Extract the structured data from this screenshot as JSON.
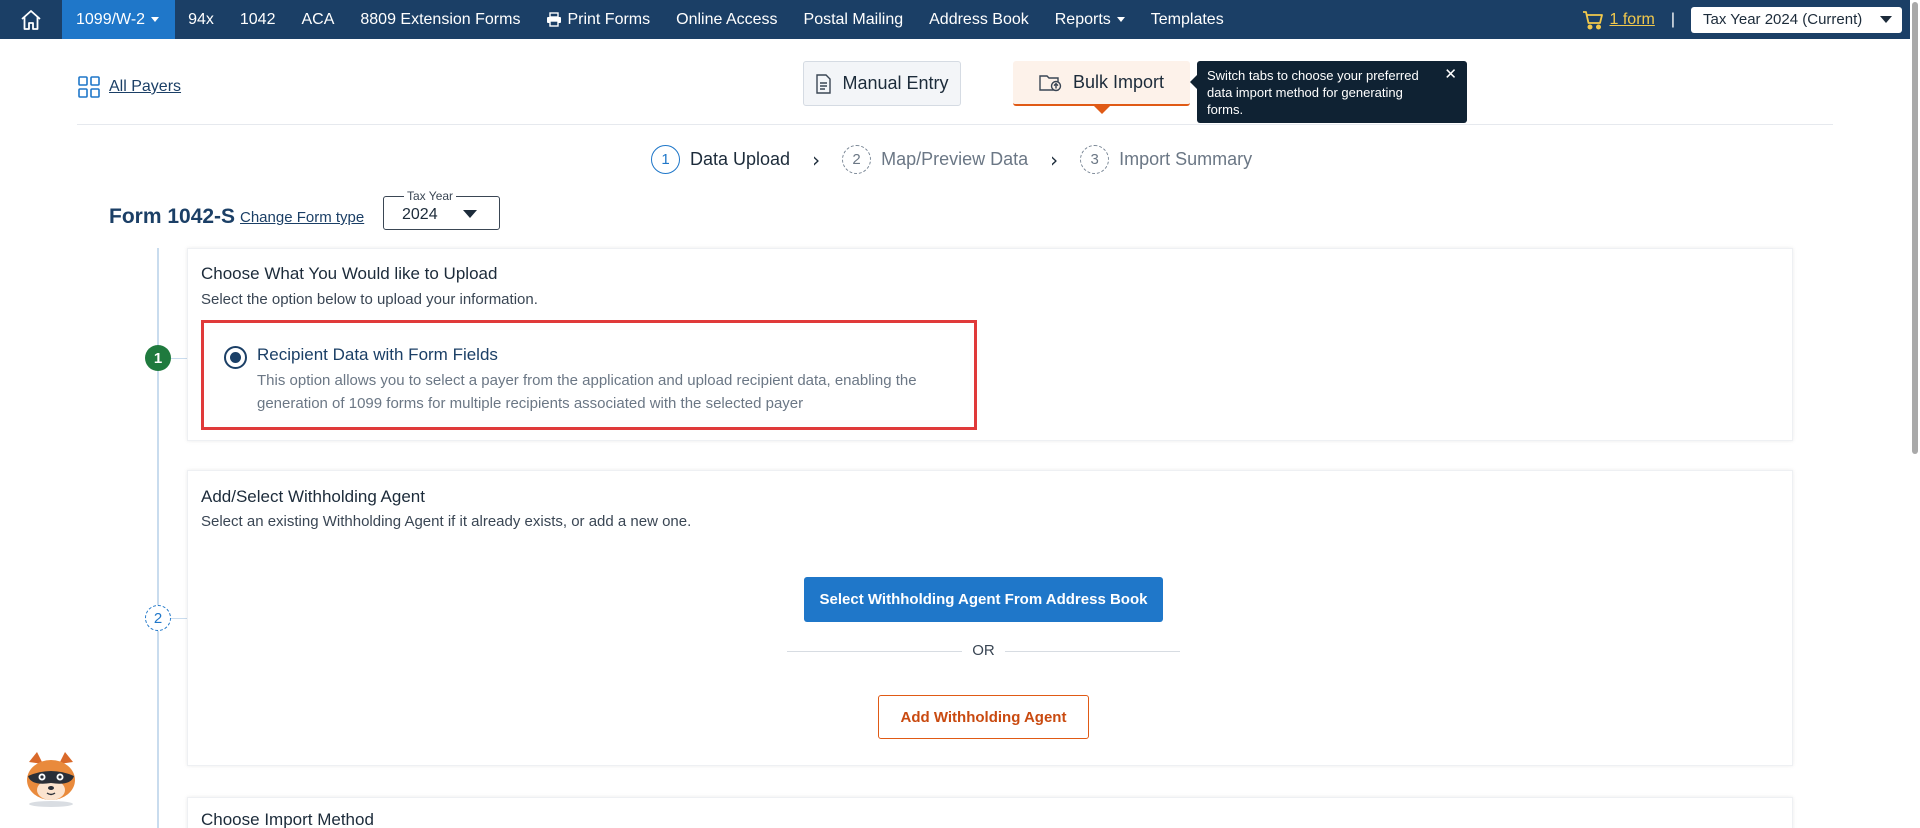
{
  "topnav": {
    "items": [
      {
        "label": "1099/W-2",
        "dropdown": true
      },
      {
        "label": "94x"
      },
      {
        "label": "1042"
      },
      {
        "label": "ACA"
      },
      {
        "label": "8809 Extension Forms"
      },
      {
        "label": "Print Forms",
        "icon": "printer-icon"
      },
      {
        "label": "Online Access"
      },
      {
        "label": "Postal Mailing"
      },
      {
        "label": "Address Book"
      },
      {
        "label": "Reports",
        "dropdown": true
      },
      {
        "label": "Templates"
      }
    ],
    "cart_label": "1 form",
    "separator": "|",
    "tax_year": "Tax Year 2024 (Current)"
  },
  "header": {
    "all_payers": "All Payers",
    "tabs": {
      "manual": "Manual Entry",
      "bulk": "Bulk Import"
    },
    "tooltip": "Switch tabs to choose your preferred data import method for generating forms.",
    "tooltip_close": "✕"
  },
  "stepper": [
    {
      "num": "1",
      "label": "Data Upload"
    },
    {
      "num": "2",
      "label": "Map/Preview Data"
    },
    {
      "num": "3",
      "label": "Import Summary"
    }
  ],
  "form": {
    "title": "Form 1042-S",
    "change_link": "Change Form type",
    "year_legend": "Tax Year",
    "year_value": "2024"
  },
  "steps": {
    "dot1": "1",
    "dot2": "2"
  },
  "card1": {
    "title": "Choose What You Would like to Upload",
    "subtitle": "Select the option below to upload your information.",
    "option_title": "Recipient Data with Form Fields",
    "option_desc": "This option allows you to select a payer from the application and upload recipient data, enabling the generation of 1099 forms for multiple recipients associated with the selected payer"
  },
  "card2": {
    "title": "Add/Select Withholding Agent",
    "subtitle": "Select an existing Withholding Agent if it already exists, or add a new one.",
    "select_button": "Select Withholding Agent From Address Book",
    "or": "OR",
    "add_button": "Add Withholding Agent"
  },
  "card3": {
    "title": "Choose Import Method"
  },
  "colors": {
    "nav_bg": "#1b3f66",
    "active_nav": "#1f77c9",
    "accent_orange": "#e05a15",
    "highlight_red": "#e03a3a",
    "step_done_green": "#1f7a3e"
  }
}
